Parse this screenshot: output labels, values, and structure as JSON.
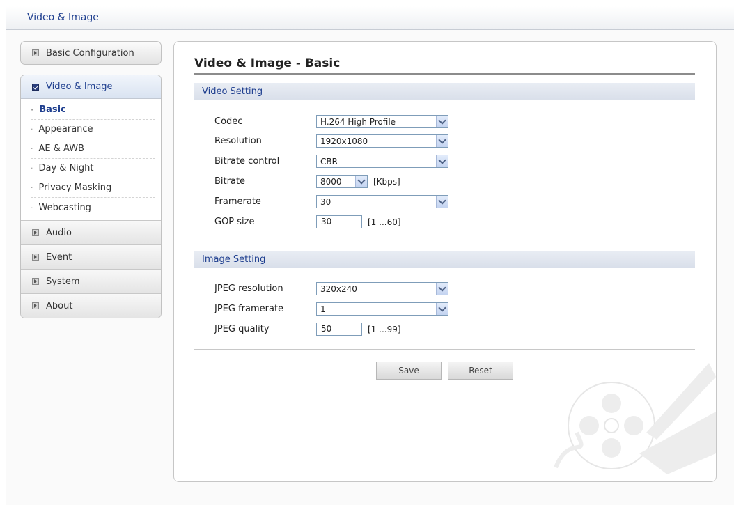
{
  "header": {
    "title": "Video & Image"
  },
  "sidebar": {
    "basic_config": "Basic Configuration",
    "video_image": {
      "label": "Video & Image",
      "items": [
        "Basic",
        "Appearance",
        "AE & AWB",
        "Day & Night",
        "Privacy Masking",
        "Webcasting"
      ]
    },
    "audio": "Audio",
    "event": "Event",
    "system": "System",
    "about": "About"
  },
  "main": {
    "title": "Video & Image - Basic",
    "video_section": "Video Setting",
    "codec": {
      "label": "Codec",
      "value": "H.264 High Profile"
    },
    "resolution": {
      "label": "Resolution",
      "value": "1920x1080"
    },
    "bitrate_control": {
      "label": "Bitrate control",
      "value": "CBR"
    },
    "bitrate": {
      "label": "Bitrate",
      "value": "8000",
      "unit": "[Kbps]"
    },
    "framerate": {
      "label": "Framerate",
      "value": "30"
    },
    "gop": {
      "label": "GOP size",
      "value": "30",
      "range": "[1 ...60]"
    },
    "image_section": "Image Setting",
    "jpeg_resolution": {
      "label": "JPEG resolution",
      "value": "320x240"
    },
    "jpeg_framerate": {
      "label": "JPEG framerate",
      "value": "1"
    },
    "jpeg_quality": {
      "label": "JPEG quality",
      "value": "50",
      "range": "[1 ...99]"
    },
    "save": "Save",
    "reset": "Reset"
  },
  "colors": {
    "accent": "#1f3f8f",
    "section_bg": "#dfe4ed",
    "border": "#7f9db9"
  },
  "icons": {
    "menu_collapsed": "collapsed-box-icon",
    "menu_expanded": "checked-box-icon",
    "dropdown": "chevron-down-icon"
  }
}
